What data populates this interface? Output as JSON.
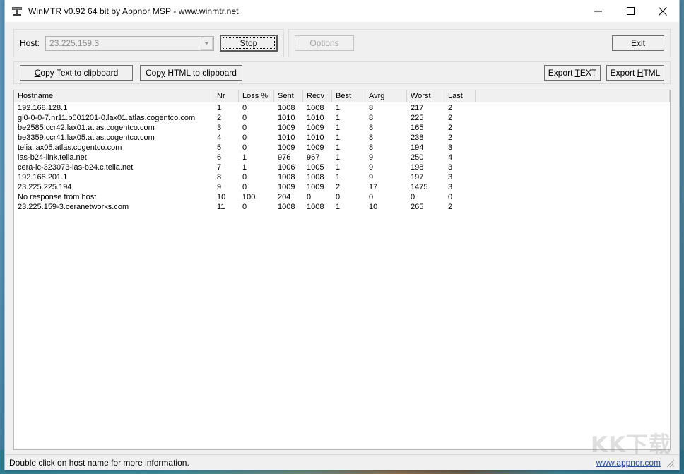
{
  "window": {
    "title": "WinMTR v0.92 64 bit by Appnor MSP - www.winmtr.net",
    "icon": "antenna-icon",
    "controls": {
      "minimize": "minimize-icon",
      "maximize": "maximize-icon",
      "close": "close-icon"
    }
  },
  "toolbar": {
    "host_label": "Host:",
    "host_value": "23.225.159.3",
    "host_placeholder": "23.225.159.3",
    "dropdown_icon": "chevron-down-icon",
    "stop_label": "Stop",
    "options_label": "Options",
    "options_accel": "O",
    "exit_label": "Exit",
    "exit_accel": "x",
    "copy_text_label": "Copy Text to clipboard",
    "copy_text_accel": "C",
    "copy_html_label": "Copy HTML to clipboard",
    "copy_html_accel": "py",
    "export_text_label": "Export TEXT",
    "export_text_accel": "T",
    "export_html_label": "Export HTML",
    "export_html_accel": "H"
  },
  "table": {
    "columns": [
      "Hostname",
      "Nr",
      "Loss %",
      "Sent",
      "Recv",
      "Best",
      "Avrg",
      "Worst",
      "Last",
      ""
    ],
    "rows": [
      [
        "192.168.128.1",
        "1",
        "0",
        "1008",
        "1008",
        "1",
        "8",
        "217",
        "2",
        ""
      ],
      [
        "gi0-0-0-7.nr11.b001201-0.lax01.atlas.cogentco.com",
        "2",
        "0",
        "1010",
        "1010",
        "1",
        "8",
        "225",
        "2",
        ""
      ],
      [
        "be2585.ccr42.lax01.atlas.cogentco.com",
        "3",
        "0",
        "1009",
        "1009",
        "1",
        "8",
        "165",
        "2",
        ""
      ],
      [
        "be3359.ccr41.lax05.atlas.cogentco.com",
        "4",
        "0",
        "1010",
        "1010",
        "1",
        "8",
        "238",
        "2",
        ""
      ],
      [
        "telia.lax05.atlas.cogentco.com",
        "5",
        "0",
        "1009",
        "1009",
        "1",
        "8",
        "194",
        "3",
        ""
      ],
      [
        "las-b24-link.telia.net",
        "6",
        "1",
        "976",
        "967",
        "1",
        "9",
        "250",
        "4",
        ""
      ],
      [
        "cera-ic-323073-las-b24.c.telia.net",
        "7",
        "1",
        "1006",
        "1005",
        "1",
        "9",
        "198",
        "3",
        ""
      ],
      [
        "192.168.201.1",
        "8",
        "0",
        "1008",
        "1008",
        "1",
        "9",
        "197",
        "3",
        ""
      ],
      [
        "23.225.225.194",
        "9",
        "0",
        "1009",
        "1009",
        "2",
        "17",
        "1475",
        "3",
        ""
      ],
      [
        "No response from host",
        "10",
        "100",
        "204",
        "0",
        "0",
        "0",
        "0",
        "0",
        ""
      ],
      [
        "23.225.159-3.ceranetworks.com",
        "11",
        "0",
        "1008",
        "1008",
        "1",
        "10",
        "265",
        "2",
        ""
      ]
    ]
  },
  "statusbar": {
    "text": "Double click on host name for more information.",
    "link": "www.appnor.com"
  },
  "watermark": {
    "text": "KK下载"
  },
  "colors": {
    "window_bg": "#f0f0f0",
    "list_bg": "#ffffff",
    "link": "#2b4f9e",
    "disabled_text": "#a6a6a6",
    "border": "#b9b9b9"
  }
}
